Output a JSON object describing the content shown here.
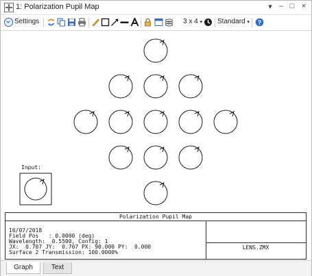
{
  "window": {
    "title": "1: Polarization Pupil Map",
    "controls": {
      "dropdown": "▾",
      "minimize": "–",
      "maximize": "□",
      "close": "×"
    }
  },
  "toolbar": {
    "settings_label": "Settings",
    "layout_label": "3 x 4",
    "layout_caret": "▾",
    "standard_label": "Standard",
    "standard_caret": "▾",
    "icons": [
      "settings-chevron-icon",
      "refresh-icon",
      "copy-icon",
      "save-icon",
      "print-icon",
      "pencil-icon",
      "rectangle-icon",
      "line-arrow-icon",
      "line-icon",
      "text-icon",
      "lock-icon",
      "window-icon",
      "layers-icon",
      "clock-icon",
      "help-icon"
    ]
  },
  "plot": {
    "input_label": "Input:"
  },
  "info": {
    "title": "Polarization Pupil Map",
    "lines": [
      "16/07/2018",
      "Field Pos   : 0.0000 (deg)",
      "Wavelength:  0.5500, Config: 1",
      "JX:  0.707 JY:  0.707 PX: 90.000 PY:  0.000",
      "Surface 2 Transmission: 100.0000%"
    ],
    "lens_file": "LENS.ZMX"
  },
  "tabs": [
    {
      "label": "Graph",
      "active": true
    },
    {
      "label": "Text",
      "active": false
    }
  ],
  "colors": {
    "ellipse_stroke": "#1a1a1a",
    "help_blue": "#2a6fd6",
    "refresh_orange": "#e0892a",
    "pencil_orange": "#f0a020"
  }
}
